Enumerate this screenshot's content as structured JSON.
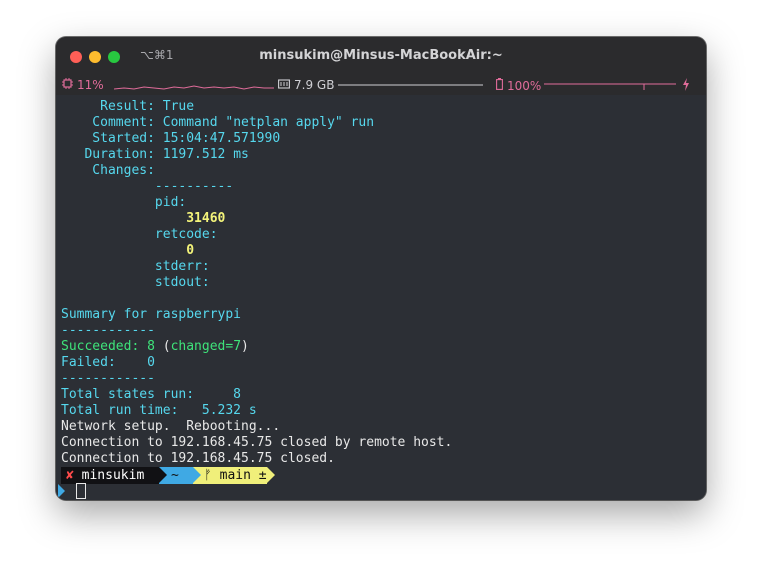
{
  "window": {
    "title": "minsukim@Minsus-MacBookAir:~",
    "shortcut": "⌥⌘1",
    "colors": {
      "close": "#ff5f57",
      "minimize": "#febc2e",
      "zoom": "#28c840"
    }
  },
  "status": {
    "cpu": "11%",
    "memory": "7.9 GB",
    "battery": "100%",
    "cpu_icon": "cpu-chip-icon",
    "memory_icon": "memory-icon",
    "battery_icon": "battery-icon",
    "charging_icon": "lightning-icon"
  },
  "terminal": {
    "result": {
      "label": "     Result: ",
      "value": "True"
    },
    "comment": {
      "label": "    Comment: ",
      "value": "Command \"netplan apply\" run"
    },
    "started": {
      "label": "    Started: ",
      "value": "15:04:47.571990"
    },
    "duration": {
      "label": "   Duration: ",
      "value": "1197.512 ms"
    },
    "changes": {
      "label": "    Changes:"
    },
    "separator_long": "            ----------",
    "pid_label": "            pid:",
    "pid_value": "                31460",
    "retcode_label": "            retcode:",
    "retcode_value": "                0",
    "stderr_label": "            stderr:",
    "stdout_label": "            stdout:",
    "summary": "Summary for raspberrypi",
    "separator_short": "------------",
    "succeeded": {
      "label": "Succeeded: 8",
      "open": " (",
      "changed": "changed=7",
      "close": ")"
    },
    "failed": "Failed:    0",
    "separator_short2": "------------",
    "total_states": "Total states run:     8",
    "total_time": "Total run time:   5.232 s",
    "network": "Network setup.  Rebooting...",
    "conn1": "Connection to 192.168.45.75 closed by remote host.",
    "conn2": "Connection to 192.168.45.75 closed."
  },
  "prompt": {
    "status_glyph": "✘",
    "user": "minsukim",
    "dir": "~",
    "branch_glyph": "ᚠ",
    "branch": "main ±"
  }
}
